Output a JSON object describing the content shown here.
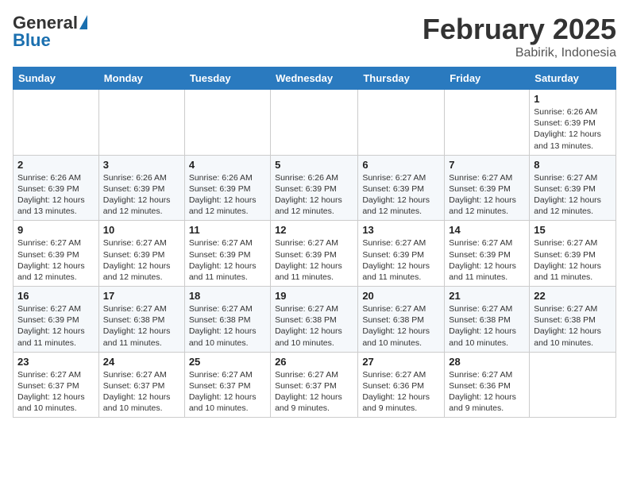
{
  "header": {
    "logo_general": "General",
    "logo_blue": "Blue",
    "month_title": "February 2025",
    "location": "Babirik, Indonesia"
  },
  "weekdays": [
    "Sunday",
    "Monday",
    "Tuesday",
    "Wednesday",
    "Thursday",
    "Friday",
    "Saturday"
  ],
  "weeks": [
    [
      {
        "day": "",
        "info": ""
      },
      {
        "day": "",
        "info": ""
      },
      {
        "day": "",
        "info": ""
      },
      {
        "day": "",
        "info": ""
      },
      {
        "day": "",
        "info": ""
      },
      {
        "day": "",
        "info": ""
      },
      {
        "day": "1",
        "info": "Sunrise: 6:26 AM\nSunset: 6:39 PM\nDaylight: 12 hours\nand 13 minutes."
      }
    ],
    [
      {
        "day": "2",
        "info": "Sunrise: 6:26 AM\nSunset: 6:39 PM\nDaylight: 12 hours\nand 13 minutes."
      },
      {
        "day": "3",
        "info": "Sunrise: 6:26 AM\nSunset: 6:39 PM\nDaylight: 12 hours\nand 12 minutes."
      },
      {
        "day": "4",
        "info": "Sunrise: 6:26 AM\nSunset: 6:39 PM\nDaylight: 12 hours\nand 12 minutes."
      },
      {
        "day": "5",
        "info": "Sunrise: 6:26 AM\nSunset: 6:39 PM\nDaylight: 12 hours\nand 12 minutes."
      },
      {
        "day": "6",
        "info": "Sunrise: 6:27 AM\nSunset: 6:39 PM\nDaylight: 12 hours\nand 12 minutes."
      },
      {
        "day": "7",
        "info": "Sunrise: 6:27 AM\nSunset: 6:39 PM\nDaylight: 12 hours\nand 12 minutes."
      },
      {
        "day": "8",
        "info": "Sunrise: 6:27 AM\nSunset: 6:39 PM\nDaylight: 12 hours\nand 12 minutes."
      }
    ],
    [
      {
        "day": "9",
        "info": "Sunrise: 6:27 AM\nSunset: 6:39 PM\nDaylight: 12 hours\nand 12 minutes."
      },
      {
        "day": "10",
        "info": "Sunrise: 6:27 AM\nSunset: 6:39 PM\nDaylight: 12 hours\nand 12 minutes."
      },
      {
        "day": "11",
        "info": "Sunrise: 6:27 AM\nSunset: 6:39 PM\nDaylight: 12 hours\nand 11 minutes."
      },
      {
        "day": "12",
        "info": "Sunrise: 6:27 AM\nSunset: 6:39 PM\nDaylight: 12 hours\nand 11 minutes."
      },
      {
        "day": "13",
        "info": "Sunrise: 6:27 AM\nSunset: 6:39 PM\nDaylight: 12 hours\nand 11 minutes."
      },
      {
        "day": "14",
        "info": "Sunrise: 6:27 AM\nSunset: 6:39 PM\nDaylight: 12 hours\nand 11 minutes."
      },
      {
        "day": "15",
        "info": "Sunrise: 6:27 AM\nSunset: 6:39 PM\nDaylight: 12 hours\nand 11 minutes."
      }
    ],
    [
      {
        "day": "16",
        "info": "Sunrise: 6:27 AM\nSunset: 6:39 PM\nDaylight: 12 hours\nand 11 minutes."
      },
      {
        "day": "17",
        "info": "Sunrise: 6:27 AM\nSunset: 6:38 PM\nDaylight: 12 hours\nand 11 minutes."
      },
      {
        "day": "18",
        "info": "Sunrise: 6:27 AM\nSunset: 6:38 PM\nDaylight: 12 hours\nand 10 minutes."
      },
      {
        "day": "19",
        "info": "Sunrise: 6:27 AM\nSunset: 6:38 PM\nDaylight: 12 hours\nand 10 minutes."
      },
      {
        "day": "20",
        "info": "Sunrise: 6:27 AM\nSunset: 6:38 PM\nDaylight: 12 hours\nand 10 minutes."
      },
      {
        "day": "21",
        "info": "Sunrise: 6:27 AM\nSunset: 6:38 PM\nDaylight: 12 hours\nand 10 minutes."
      },
      {
        "day": "22",
        "info": "Sunrise: 6:27 AM\nSunset: 6:38 PM\nDaylight: 12 hours\nand 10 minutes."
      }
    ],
    [
      {
        "day": "23",
        "info": "Sunrise: 6:27 AM\nSunset: 6:37 PM\nDaylight: 12 hours\nand 10 minutes."
      },
      {
        "day": "24",
        "info": "Sunrise: 6:27 AM\nSunset: 6:37 PM\nDaylight: 12 hours\nand 10 minutes."
      },
      {
        "day": "25",
        "info": "Sunrise: 6:27 AM\nSunset: 6:37 PM\nDaylight: 12 hours\nand 10 minutes."
      },
      {
        "day": "26",
        "info": "Sunrise: 6:27 AM\nSunset: 6:37 PM\nDaylight: 12 hours\nand 9 minutes."
      },
      {
        "day": "27",
        "info": "Sunrise: 6:27 AM\nSunset: 6:36 PM\nDaylight: 12 hours\nand 9 minutes."
      },
      {
        "day": "28",
        "info": "Sunrise: 6:27 AM\nSunset: 6:36 PM\nDaylight: 12 hours\nand 9 minutes."
      },
      {
        "day": "",
        "info": ""
      }
    ]
  ]
}
